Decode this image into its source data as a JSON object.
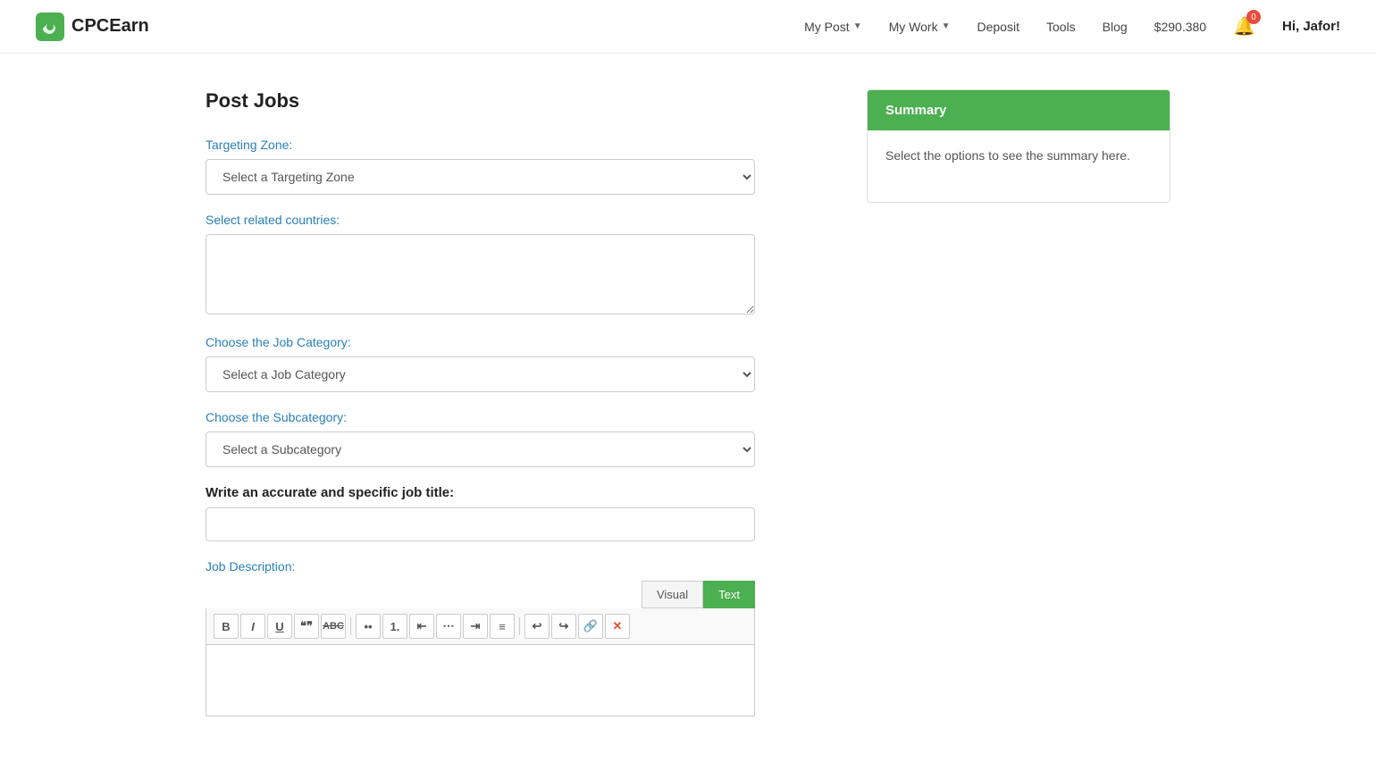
{
  "header": {
    "logo_text": "CPCEarn",
    "nav": {
      "my_post": "My Post",
      "my_work": "My Work",
      "deposit": "Deposit",
      "tools": "Tools",
      "blog": "Blog",
      "balance": "$290.380",
      "notification_count": "0",
      "greeting": "Hi, Jafor!"
    }
  },
  "page": {
    "title": "Post Jobs"
  },
  "form": {
    "targeting_zone_label": "Targeting Zone:",
    "targeting_zone_placeholder": "Select a Targeting Zone",
    "related_countries_label": "Select related countries:",
    "job_category_label": "Choose the Job Category:",
    "job_category_placeholder": "Select a Job Category",
    "subcategory_label": "Choose the Subcategory:",
    "subcategory_placeholder": "Select a Subcategory",
    "job_title_label": "Write an accurate and specific job title:",
    "job_description_label": "Job Description:"
  },
  "editor": {
    "tab_visual": "Visual",
    "tab_text": "Text",
    "active_tab": "Text",
    "toolbar_buttons": [
      "B",
      "I",
      "U",
      "❝",
      "ABC",
      "≡",
      "≡",
      "≡",
      "≡",
      "≡",
      "↩",
      "↪",
      "🔗",
      "✕"
    ]
  },
  "summary": {
    "header": "Summary",
    "body_text": "Select the options to see the summary here."
  }
}
